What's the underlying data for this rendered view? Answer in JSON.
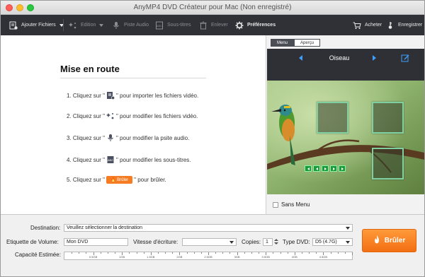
{
  "window": {
    "title": "AnyMP4 DVD Créateur pour Mac (Non enregistré)"
  },
  "toolbar": {
    "add_files": "Ajouter Fichiers",
    "edit": "Edition",
    "audio": "Piste Audio",
    "subtitles": "Sous-titres",
    "remove": "Enlever",
    "preferences": "Préférences",
    "buy": "Acheter",
    "register": "Enregistrer"
  },
  "getting_started": {
    "title": "Mise en route",
    "steps": [
      {
        "prefix": "1. Cliquez sur \"",
        "icon": "add-file-icon",
        "suffix": "\" pour importer les fichiers vidéo."
      },
      {
        "prefix": "2. Cliquez sur \"",
        "icon": "magic-edit-icon",
        "suffix": "\" pour modifier les fichiers vidéo."
      },
      {
        "prefix": "3. Cliquez sur \"",
        "icon": "microphone-icon",
        "suffix": "\" pour modifier la psite audio."
      },
      {
        "prefix": "4. Cliquez sur \"",
        "icon": "subtitle-icon",
        "suffix": "\" pour modifier les sous-titres."
      },
      {
        "prefix": "5. Cliquez sur \"",
        "button": "Brûler",
        "suffix": "\" pour brûler."
      }
    ]
  },
  "menu_panel": {
    "tabs": [
      "Menu",
      "Aperçu"
    ],
    "active_tab": "Menu",
    "theme_name": "Oiseau",
    "no_menu_label": "Sans Menu",
    "no_menu_checked": false
  },
  "bottom": {
    "destination_label": "Destination:",
    "destination_value": "Veuillez sélectionner la destination",
    "volume_label": "Etiquette de Volume:",
    "volume_value": "Mon DVD",
    "write_speed_label": "Vitesse d'écriture:",
    "write_speed_value": "",
    "copies_label": "Copies:",
    "copies_value": "1",
    "dvd_type_label": "Type DVD:",
    "dvd_type_value": "D5 (4.7G)",
    "capacity_label": "Capacité Estimée:",
    "capacity_ticks": [
      "0.5GB",
      "1GB",
      "1.5GB",
      "2GB",
      "2.5GB",
      "3GB",
      "3.5GB",
      "4GB",
      "4.5GB"
    ],
    "burn_label": "Brûler"
  },
  "colors": {
    "accent": "#f57c23",
    "toolbar_bg": "#2f3137",
    "link_blue": "#3e9fff"
  }
}
